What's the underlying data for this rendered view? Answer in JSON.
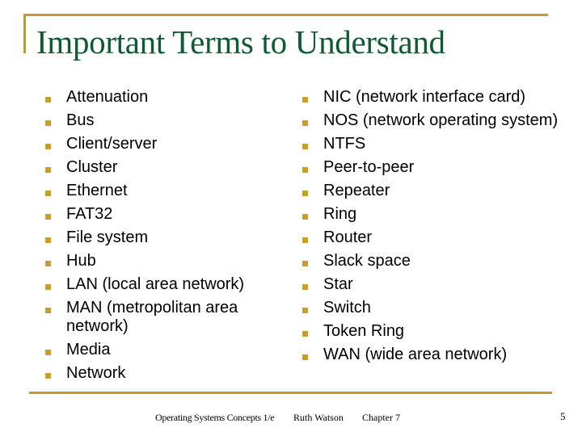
{
  "slide": {
    "title": "Important Terms to Understand",
    "left_terms": [
      "Attenuation",
      "Bus",
      "Client/server",
      "Cluster",
      "Ethernet",
      "FAT32",
      "File system",
      "Hub",
      "LAN (local area network)",
      "MAN (metropolitan area network)",
      "Media",
      "Network"
    ],
    "right_terms": [
      "NIC (network interface card)",
      "NOS (network operating system)",
      "NTFS",
      "Peer-to-peer",
      "Repeater",
      "Ring",
      "Router",
      "Slack space",
      "Star",
      "Switch",
      "Token Ring",
      "WAN (wide area network)"
    ],
    "bullet_icon": "square-bullet-icon"
  },
  "footer": {
    "course": "Operating Systems Concepts 1/e",
    "author": "Ruth Watson",
    "chapter": "Chapter 7",
    "page_number": "5"
  },
  "colors": {
    "title": "#0E5A32",
    "accent_rule": "#C09A2A",
    "bullet": "#C8A028",
    "text": "#000000"
  }
}
